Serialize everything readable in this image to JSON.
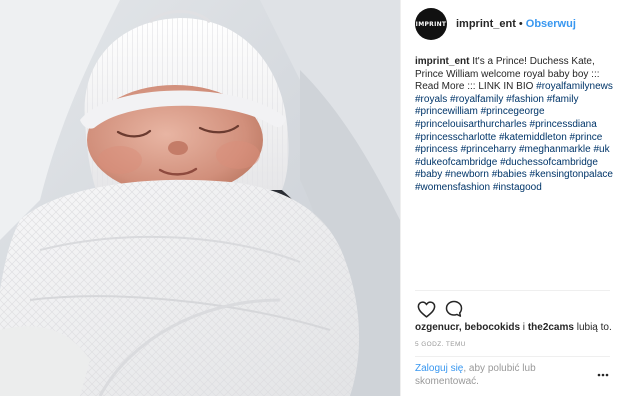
{
  "header": {
    "avatar_text": "IMPRINT",
    "username": "imprint_ent",
    "separator": "•",
    "follow_label": "Obserwuj"
  },
  "caption": {
    "username": "imprint_ent",
    "text": "It's a Prince! Duchess Kate, Prince William welcome royal baby boy ::: Read More ::: LINK IN BIO",
    "hashtags": [
      "#royalfamilynews",
      "#royals",
      "#royalfamily",
      "#fashion",
      "#family",
      "#princewilliam",
      "#princegeorge",
      "#princelouisarthurcharles",
      "#princessdiana",
      "#princesscharlotte",
      "#katemiddleton",
      "#prince",
      "#princess",
      "#princeharry",
      "#meghanmarkle",
      "#uk",
      "#dukeofcambridge",
      "#duchessofcambridge",
      "#baby",
      "#newborn",
      "#babies",
      "#kensingtonpalace",
      "#womensfashion",
      "#instagood"
    ]
  },
  "actions": {
    "like_icon": "heart-outline-icon",
    "comment_icon": "speech-bubble-icon"
  },
  "likes": {
    "users": "ozgenucr, bebocokids",
    "joiner": " i ",
    "others": "the2cams",
    "suffix": " lubią to."
  },
  "timestamp": "5 GODZ. TEMU",
  "login": {
    "link": "Zaloguj się",
    "rest": ", aby polubić lub skomentować."
  },
  "more_icon": "ellipsis-icon",
  "colors": {
    "link_blue": "#3897f0",
    "hashtag": "#003569",
    "text": "#262626",
    "muted": "#999999",
    "divider": "#efefef"
  }
}
